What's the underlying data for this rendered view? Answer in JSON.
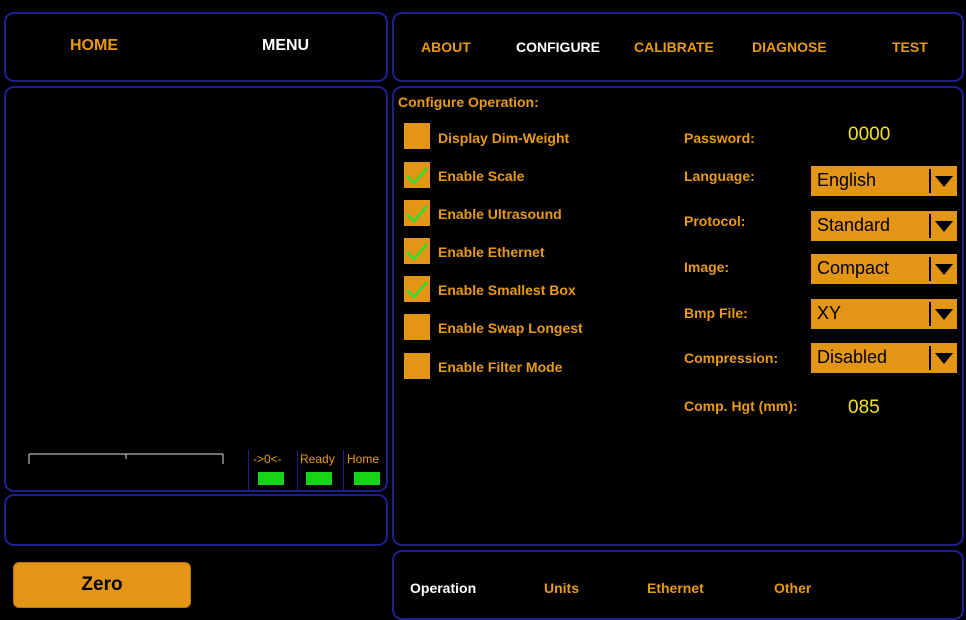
{
  "header": {
    "home_label": "HOME",
    "menu_label": "MENU",
    "nav": [
      "ABOUT",
      "CONFIGURE",
      "CALIBRATE",
      "DIAGNOSE",
      "TEST"
    ],
    "active_nav": "CONFIGURE"
  },
  "configure": {
    "title": "Configure Operation:",
    "options": [
      {
        "label": "Display Dim-Weight",
        "checked": false
      },
      {
        "label": "Enable Scale",
        "checked": true
      },
      {
        "label": "Enable Ultrasound",
        "checked": true
      },
      {
        "label": "Enable Ethernet",
        "checked": true
      },
      {
        "label": "Enable Smallest Box",
        "checked": true
      },
      {
        "label": "Enable Swap Longest",
        "checked": false
      },
      {
        "label": "Enable Filter Mode",
        "checked": false
      }
    ],
    "password": {
      "label": "Password:",
      "value": "0000"
    },
    "language": {
      "label": "Language:",
      "value": "English"
    },
    "protocol": {
      "label": "Protocol:",
      "value": "Standard"
    },
    "image": {
      "label": "Image:",
      "value": "Compact"
    },
    "bmp_file": {
      "label": "Bmp File:",
      "value": "XY"
    },
    "compression": {
      "label": "Compression:",
      "value": "Disabled"
    },
    "comp_hgt": {
      "label": "Comp. Hgt (mm):",
      "value": "085"
    }
  },
  "status": {
    "indicators": [
      {
        "label": "->0<-",
        "color": "#18d418"
      },
      {
        "label": "Ready",
        "color": "#18d418"
      },
      {
        "label": "Home",
        "color": "#18d418"
      }
    ]
  },
  "footer": {
    "zero_label": "Zero",
    "tabs": [
      "Operation",
      "Units",
      "Ethernet",
      "Other"
    ],
    "active_tab": "Operation"
  },
  "colors": {
    "accent": "#e39516",
    "border": "#1c1f8c",
    "value_yellow": "#f2e21a",
    "indicator_green": "#18d418"
  },
  "icons": {
    "check": "check-icon",
    "dropdown": "chevron-down-icon"
  }
}
